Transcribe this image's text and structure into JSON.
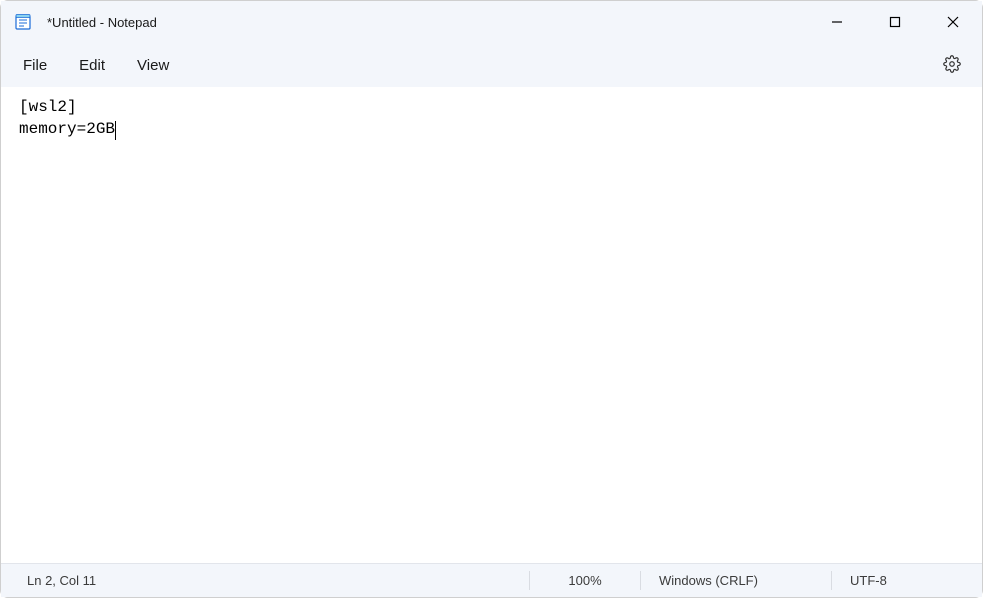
{
  "window": {
    "title": "*Untitled - Notepad"
  },
  "menu": {
    "file": "File",
    "edit": "Edit",
    "view": "View"
  },
  "editor": {
    "content": "[wsl2]\nmemory=2GB"
  },
  "status": {
    "position": "Ln 2, Col 11",
    "zoom": "100%",
    "line_ending": "Windows (CRLF)",
    "encoding": "UTF-8"
  }
}
